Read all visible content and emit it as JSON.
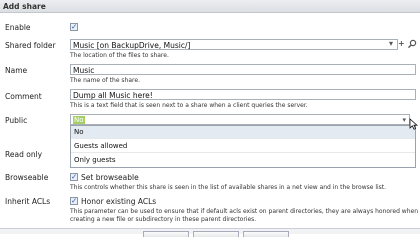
{
  "dialog": {
    "title": "Add share"
  },
  "fields": {
    "enable": {
      "label": "Enable",
      "checked": true
    },
    "shared_folder": {
      "label": "Shared folder",
      "value": "Music [on BackupDrive, Music/]",
      "hint": "The location of the files to share."
    },
    "name": {
      "label": "Name",
      "value": "Music",
      "hint": "The name of the share."
    },
    "comment": {
      "label": "Comment",
      "value": "Dump all Music here!",
      "hint": "This is a text field that is seen next to a share when a client queries the server."
    },
    "public": {
      "label": "Public",
      "value": "No",
      "options": [
        "No",
        "Guests allowed",
        "Only guests"
      ]
    },
    "read_only": {
      "label": "Read only"
    },
    "browseable": {
      "label": "Browseable",
      "checked": true,
      "check_label": "Set browseable",
      "hint": "This controls whether this share is seen in the list of available shares in a net view and in the browse list."
    },
    "inherit_acls": {
      "label": "Inherit ACLs",
      "checked": true,
      "check_label": "Honor existing ACLs",
      "hint": "This parameter can be used to ensure that if default acls exist on parent directories, they are always honored when",
      "hint2": "creating a new file or subdirectory in these parent directories."
    }
  },
  "icons": {
    "dropdown": "chevron-down-icon",
    "add": "plus-icon",
    "search": "search-icon",
    "cursor": "mouse-pointer-icon"
  },
  "colors": {
    "selection": "#a6cf68",
    "titlebar": "#dcdfe3",
    "checkmark": "#2b5aa8"
  }
}
